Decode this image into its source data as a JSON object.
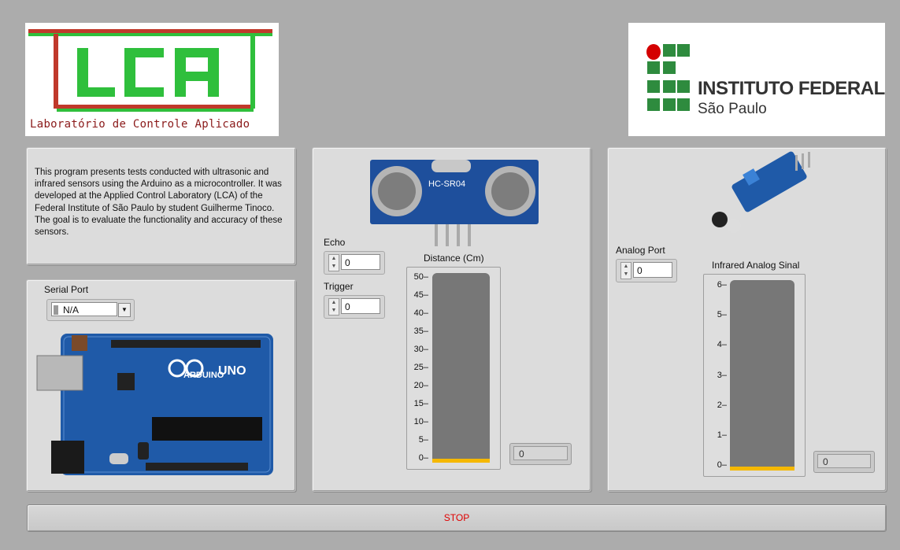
{
  "logos": {
    "lca_text": "LCA",
    "lca_subtitle": "Laboratório de Controle Aplicado",
    "if_title": "INSTITUTO FEDERAL",
    "if_subtitle": "São Paulo"
  },
  "description": "This program presents tests conducted with ultrasonic and infrared sensors using the Arduino as a microcontroller. It was developed at the Applied Control Laboratory (LCA) of the Federal Institute of São Paulo by student Guilherme Tinoco. The goal is to evaluate the functionality and accuracy of these sensors.",
  "serial": {
    "label": "Serial Port",
    "value": "N/A"
  },
  "arduino": {
    "brand": "ARDUINO",
    "model": "UNO"
  },
  "ultrasonic": {
    "module_label": "HC-SR04",
    "echo_label": "Echo",
    "echo_value": "0",
    "trigger_label": "Trigger",
    "trigger_value": "0",
    "tank_title": "Distance (Cm)",
    "ticks": [
      "50",
      "45",
      "40",
      "35",
      "30",
      "25",
      "20",
      "15",
      "10",
      "5",
      "0"
    ],
    "tank_level": 0,
    "indicator_value": "0"
  },
  "infrared": {
    "port_label": "Analog Port",
    "port_value": "0",
    "tank_title": "Infrared Analog Sinal",
    "ticks": [
      "6",
      "5",
      "4",
      "3",
      "2",
      "1",
      "0"
    ],
    "tank_level": 0,
    "indicator_value": "0"
  },
  "stop_label": "STOP",
  "colors": {
    "stop_text": "#e00000",
    "tank_fill": "#f5b800",
    "lca_green": "#2fbf3c",
    "lca_red": "#c0392b",
    "if_green": "#2e8b3e",
    "if_red": "#d40000"
  }
}
